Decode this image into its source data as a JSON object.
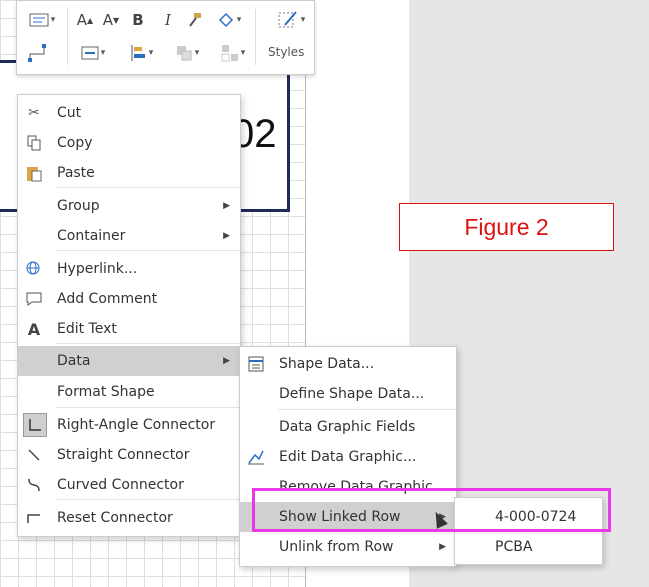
{
  "canvas": {
    "shape_text": "02"
  },
  "figure_label": "Figure 2",
  "toolbar": {
    "styles_label": "Styles",
    "bold": "B",
    "italic": "I",
    "font_up": "A",
    "font_down": "A",
    "text_color": "A"
  },
  "context_menu": {
    "items": [
      {
        "label": "Cut",
        "icon": "scissors-icon"
      },
      {
        "label": "Copy",
        "icon": "copy-icon"
      },
      {
        "label": "Paste",
        "icon": "paste-icon"
      },
      {
        "label": "Group",
        "submenu": true
      },
      {
        "label": "Container",
        "submenu": true
      },
      {
        "label": "Hyperlink...",
        "icon": "hyperlink-icon"
      },
      {
        "label": "Add Comment",
        "icon": "comment-icon"
      },
      {
        "label": "Edit Text",
        "icon": "edit-text-icon",
        "icon_glyph": "A"
      },
      {
        "label": "Data",
        "submenu": true,
        "highlighted": true
      },
      {
        "label": "Format Shape"
      },
      {
        "label": "Right-Angle Connector",
        "icon": "right-angle-connector-icon"
      },
      {
        "label": "Straight Connector",
        "icon": "straight-connector-icon"
      },
      {
        "label": "Curved Connector",
        "icon": "curved-connector-icon"
      },
      {
        "label": "Reset Connector",
        "icon": "reset-connector-icon"
      }
    ]
  },
  "data_submenu": {
    "items": [
      {
        "label": "Shape Data...",
        "icon": "shape-data-icon"
      },
      {
        "label": "Define Shape Data..."
      },
      {
        "label": "Data Graphic Fields"
      },
      {
        "label": "Edit Data Graphic...",
        "icon": "edit-data-graphic-icon"
      },
      {
        "label": "Remove Data Graphic"
      },
      {
        "label": "Show Linked Row",
        "submenu": true,
        "highlighted": true
      },
      {
        "label": "Unlink from Row",
        "submenu": true
      }
    ]
  },
  "linked_row_submenu": {
    "items": [
      {
        "label": "4-000-0724"
      },
      {
        "label": "PCBA"
      }
    ]
  },
  "colors": {
    "annotation_red": "#dd1111",
    "annotation_magenta": "#e838e8",
    "highlight": "#d0d0d0"
  }
}
